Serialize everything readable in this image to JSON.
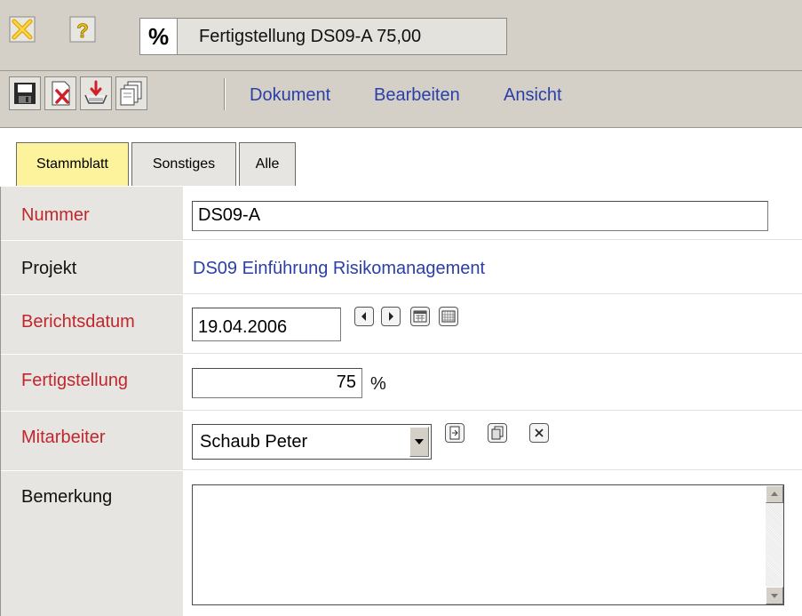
{
  "title_bar": {
    "percent_symbol": "%",
    "title": "Fertigstellung DS09-A 75,00"
  },
  "toolbar": {
    "icons": [
      "save-icon",
      "delete-icon",
      "import-icon",
      "copy-icon"
    ],
    "menu": [
      "Dokument",
      "Bearbeiten",
      "Ansicht"
    ]
  },
  "tabs": [
    {
      "label": "Stammblatt",
      "active": true
    },
    {
      "label": "Sonstiges",
      "active": false
    },
    {
      "label": "Alle",
      "active": false
    }
  ],
  "form": {
    "nummer": {
      "label": "Nummer",
      "value": "DS09-A"
    },
    "projekt": {
      "label": "Projekt",
      "value": "DS09 Einführung Risikomanagement"
    },
    "berichtsdatum": {
      "label": "Berichtsdatum",
      "value": "19.04.2006"
    },
    "fertigstellung": {
      "label": "Fertigstellung",
      "value": "75",
      "unit": "%"
    },
    "mitarbeiter": {
      "label": "Mitarbeiter",
      "value": "Schaub Peter"
    },
    "bemerkung": {
      "label": "Bemerkung",
      "value": ""
    }
  },
  "colors": {
    "required_label": "#c0272d",
    "link": "#2b3fa8",
    "active_tab": "#fcf39c",
    "chrome": "#d4d0c8"
  }
}
